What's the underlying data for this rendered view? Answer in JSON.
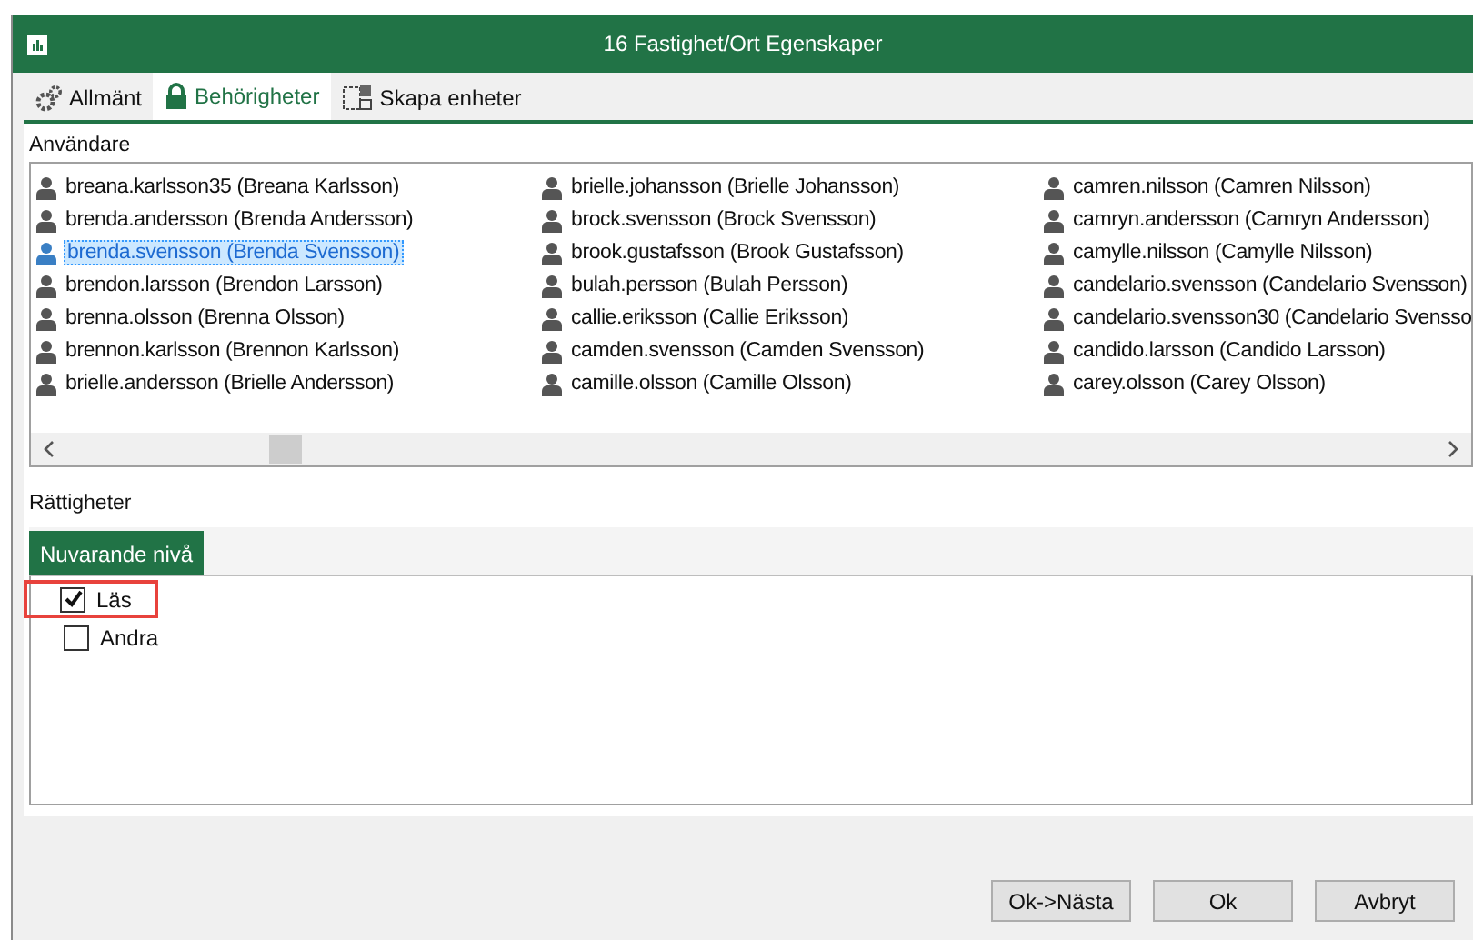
{
  "window": {
    "title": "16 Fastighet/Ort Egenskaper"
  },
  "tabs": [
    {
      "label": "Allmänt",
      "selected": false
    },
    {
      "label": "Behörigheter",
      "selected": true
    },
    {
      "label": "Skapa enheter",
      "selected": false
    }
  ],
  "users": {
    "label": "Användare",
    "items": [
      {
        "text": "breana.karlsson35 (Breana Karlsson)",
        "selected": false
      },
      {
        "text": "brenda.andersson (Brenda Andersson)",
        "selected": false
      },
      {
        "text": "brenda.svensson (Brenda Svensson)",
        "selected": true
      },
      {
        "text": "brendon.larsson (Brendon Larsson)",
        "selected": false
      },
      {
        "text": "brenna.olsson (Brenna Olsson)",
        "selected": false
      },
      {
        "text": "brennon.karlsson (Brennon Karlsson)",
        "selected": false
      },
      {
        "text": "brielle.andersson (Brielle Andersson)",
        "selected": false
      },
      {
        "text": "brielle.johansson (Brielle Johansson)",
        "selected": false
      },
      {
        "text": "brock.svensson (Brock Svensson)",
        "selected": false
      },
      {
        "text": "brook.gustafsson (Brook Gustafsson)",
        "selected": false
      },
      {
        "text": "bulah.persson (Bulah Persson)",
        "selected": false
      },
      {
        "text": "callie.eriksson (Callie Eriksson)",
        "selected": false
      },
      {
        "text": "camden.svensson (Camden Svensson)",
        "selected": false
      },
      {
        "text": "camille.olsson (Camille Olsson)",
        "selected": false
      },
      {
        "text": "camren.nilsson (Camren Nilsson)",
        "selected": false
      },
      {
        "text": "camryn.andersson (Camryn Andersson)",
        "selected": false
      },
      {
        "text": "camylle.nilsson (Camylle Nilsson)",
        "selected": false
      },
      {
        "text": "candelario.svensson (Candelario Svensson)",
        "selected": false
      },
      {
        "text": "candelario.svensson30 (Candelario Svensso",
        "selected": false
      },
      {
        "text": "candido.larsson (Candido Larsson)",
        "selected": false
      },
      {
        "text": "carey.olsson (Carey Olsson)",
        "selected": false
      }
    ]
  },
  "permissions": {
    "label": "Rättigheter",
    "tab": "Nuvarande nivå",
    "items": [
      {
        "label": "Läs",
        "checked": true,
        "highlighted": true
      },
      {
        "label": "Andra",
        "checked": false,
        "highlighted": false
      }
    ]
  },
  "buttons": [
    "Ok->Nästa",
    "Ok",
    "Avbryt"
  ]
}
